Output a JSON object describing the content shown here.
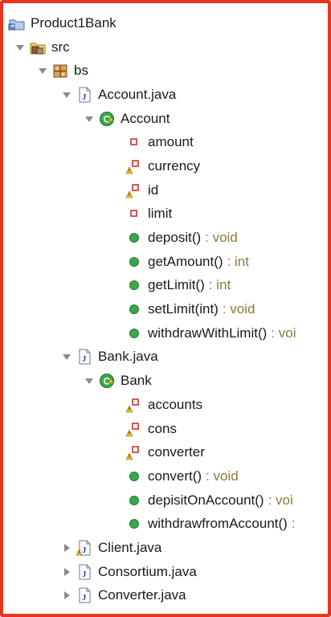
{
  "tree": {
    "project": {
      "label": "Product1Bank",
      "icon": "project-icon"
    },
    "src": {
      "label": "src",
      "icon": "source-folder-icon"
    },
    "package": {
      "label": "bs",
      "icon": "package-icon"
    },
    "files": [
      {
        "label": "Account.java",
        "icon": "java-file-icon",
        "expanded": true,
        "class": {
          "label": "Account",
          "icon": "class-icon",
          "members": [
            {
              "label": "amount",
              "kind": "private-field"
            },
            {
              "label": "currency",
              "kind": "private-field-warning"
            },
            {
              "label": "id",
              "kind": "private-field-warning"
            },
            {
              "label": "limit",
              "kind": "private-field"
            },
            {
              "label": "deposit()",
              "type": ": void",
              "kind": "public-method"
            },
            {
              "label": "getAmount()",
              "type": ": int",
              "kind": "public-method"
            },
            {
              "label": "getLimit()",
              "type": ": int",
              "kind": "public-method"
            },
            {
              "label": "setLimit(int)",
              "type": ": void",
              "kind": "public-method"
            },
            {
              "label": "withdrawWithLimit()",
              "type": ": voi",
              "kind": "public-method"
            }
          ]
        }
      },
      {
        "label": "Bank.java",
        "icon": "java-file-icon",
        "expanded": true,
        "class": {
          "label": "Bank",
          "icon": "class-icon",
          "members": [
            {
              "label": "accounts",
              "kind": "private-field-warning"
            },
            {
              "label": "cons",
              "kind": "private-field-warning"
            },
            {
              "label": "converter",
              "kind": "private-field-warning"
            },
            {
              "label": "convert()",
              "type": ": void",
              "kind": "public-method"
            },
            {
              "label": "depisitOnAccount()",
              "type": ": voi",
              "kind": "public-method"
            },
            {
              "label": "withdrawfromAccount()",
              "type": ":",
              "kind": "public-method"
            }
          ]
        }
      },
      {
        "label": "Client.java",
        "icon": "java-file-warning-icon",
        "expanded": false
      },
      {
        "label": "Consortium.java",
        "icon": "java-file-icon",
        "expanded": false
      },
      {
        "label": "Converter.java",
        "icon": "java-file-icon",
        "expanded": false
      }
    ]
  },
  "colors": {
    "frame_border": "#e8341c",
    "method_green": "#3aa84a",
    "field_red": "#c8312c",
    "warning_yellow": "#f0c020",
    "return_type": "#8a7a3a"
  }
}
